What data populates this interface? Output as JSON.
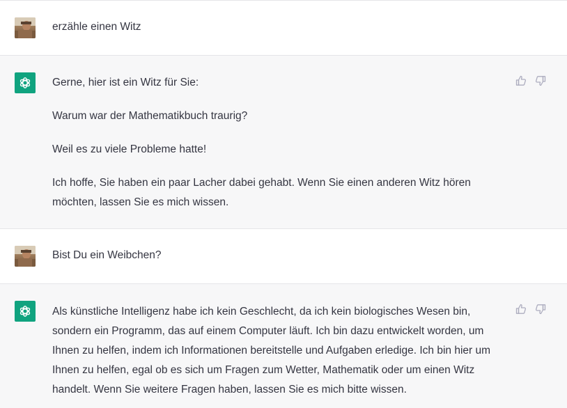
{
  "messages": [
    {
      "role": "user",
      "paragraphs": [
        "erzähle einen Witz"
      ]
    },
    {
      "role": "assistant",
      "paragraphs": [
        "Gerne, hier ist ein Witz für Sie:",
        "Warum war der Mathematikbuch traurig?",
        "Weil es zu viele Probleme hatte!",
        "Ich hoffe, Sie haben ein paar Lacher dabei gehabt. Wenn Sie einen anderen Witz hören möchten, lassen Sie es mich wissen."
      ]
    },
    {
      "role": "user",
      "paragraphs": [
        "Bist Du ein Weibchen?"
      ]
    },
    {
      "role": "assistant",
      "paragraphs": [
        "Als künstliche Intelligenz habe ich kein Geschlecht, da ich kein biologisches Wesen bin, sondern ein Programm, das auf einem Computer läuft. Ich bin dazu entwickelt worden, um Ihnen zu helfen, indem ich Informationen bereitstelle und Aufgaben erledige. Ich bin hier um Ihnen zu helfen, egal ob es sich um Fragen zum Wetter, Mathematik oder um einen Witz handelt. Wenn Sie weitere Fragen haben, lassen Sie es mich bitte wissen."
      ]
    }
  ],
  "icons": {
    "user_avatar": "user-avatar-photo",
    "assistant_avatar": "openai-logo-icon",
    "like": "thumbs-up-icon",
    "dislike": "thumbs-down-icon"
  },
  "colors": {
    "assistant_background": "#f7f7f8",
    "user_background": "#ffffff",
    "brand_green": "#10a37f",
    "text": "#343541",
    "icon_gray": "#acacbe"
  }
}
